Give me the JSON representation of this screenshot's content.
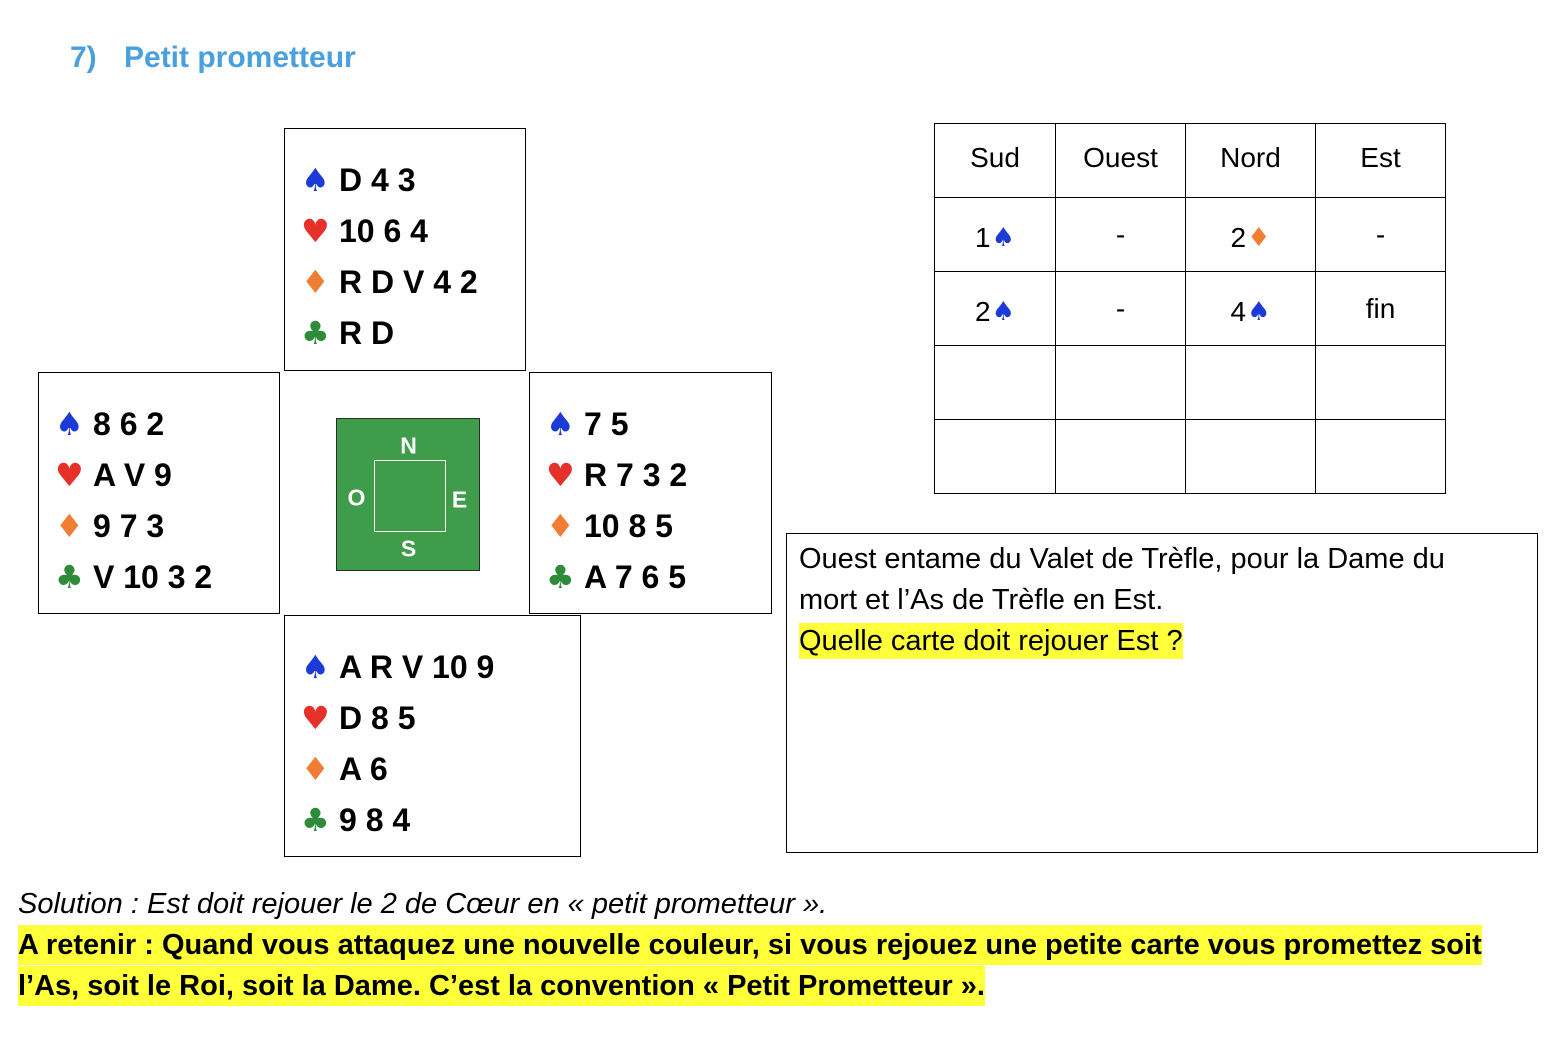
{
  "title": {
    "number": "7)",
    "text": "Petit prometteur"
  },
  "colors": {
    "title": "#4aa0dc",
    "spade": "#1b3ad8",
    "heart": "#e5312a",
    "diamond": "#ef7d33",
    "club": "#2e8b3a",
    "table_green": "#3f9c4a",
    "highlight": "#ffff3a"
  },
  "suits": {
    "spade": "♠",
    "heart": "♥",
    "diamond": "♦",
    "club": "♣"
  },
  "hands": {
    "north": {
      "spades": "D 4 3",
      "hearts": "10 6 4",
      "diamonds": "R D V 4 2",
      "clubs": "R D"
    },
    "west": {
      "spades": "8 6 2",
      "hearts": "A V 9",
      "diamonds": "9 7 3",
      "clubs": "V 10 3 2"
    },
    "east": {
      "spades": "7 5",
      "hearts": "R 7 3 2",
      "diamonds": "10 8 5",
      "clubs": "A 7 6 5"
    },
    "south": {
      "spades": "A R V 10 9",
      "hearts": "D 8 5",
      "diamonds": "A 6",
      "clubs": "9 8 4"
    }
  },
  "compass": {
    "north": "N",
    "west": "O",
    "east": "E",
    "south": "S"
  },
  "bidding": {
    "headers": [
      "Sud",
      "Ouest",
      "Nord",
      "Est"
    ],
    "rows": [
      [
        {
          "level": "1",
          "suit": "♠"
        },
        {
          "text": "-"
        },
        {
          "level": "2",
          "suit": "♦"
        },
        {
          "text": "-"
        }
      ],
      [
        {
          "level": "2",
          "suit": "♠"
        },
        {
          "text": "-"
        },
        {
          "level": "4",
          "suit": "♠"
        },
        {
          "text": "fin"
        }
      ]
    ]
  },
  "question": {
    "text": "Ouest entame du Valet de Trèfle, pour la Dame du mort et l’As de Trèfle en Est.",
    "prompt": "Quelle carte doit rejouer Est ?"
  },
  "solution": "Solution : Est doit rejouer le 2 de Cœur en « petit prometteur ».",
  "retenir": "A retenir : Quand vous attaquez une nouvelle couleur, si vous rejouez une petite carte vous promettez soit l’As, soit le Roi, soit la Dame. C’est la convention « Petit Prometteur »."
}
